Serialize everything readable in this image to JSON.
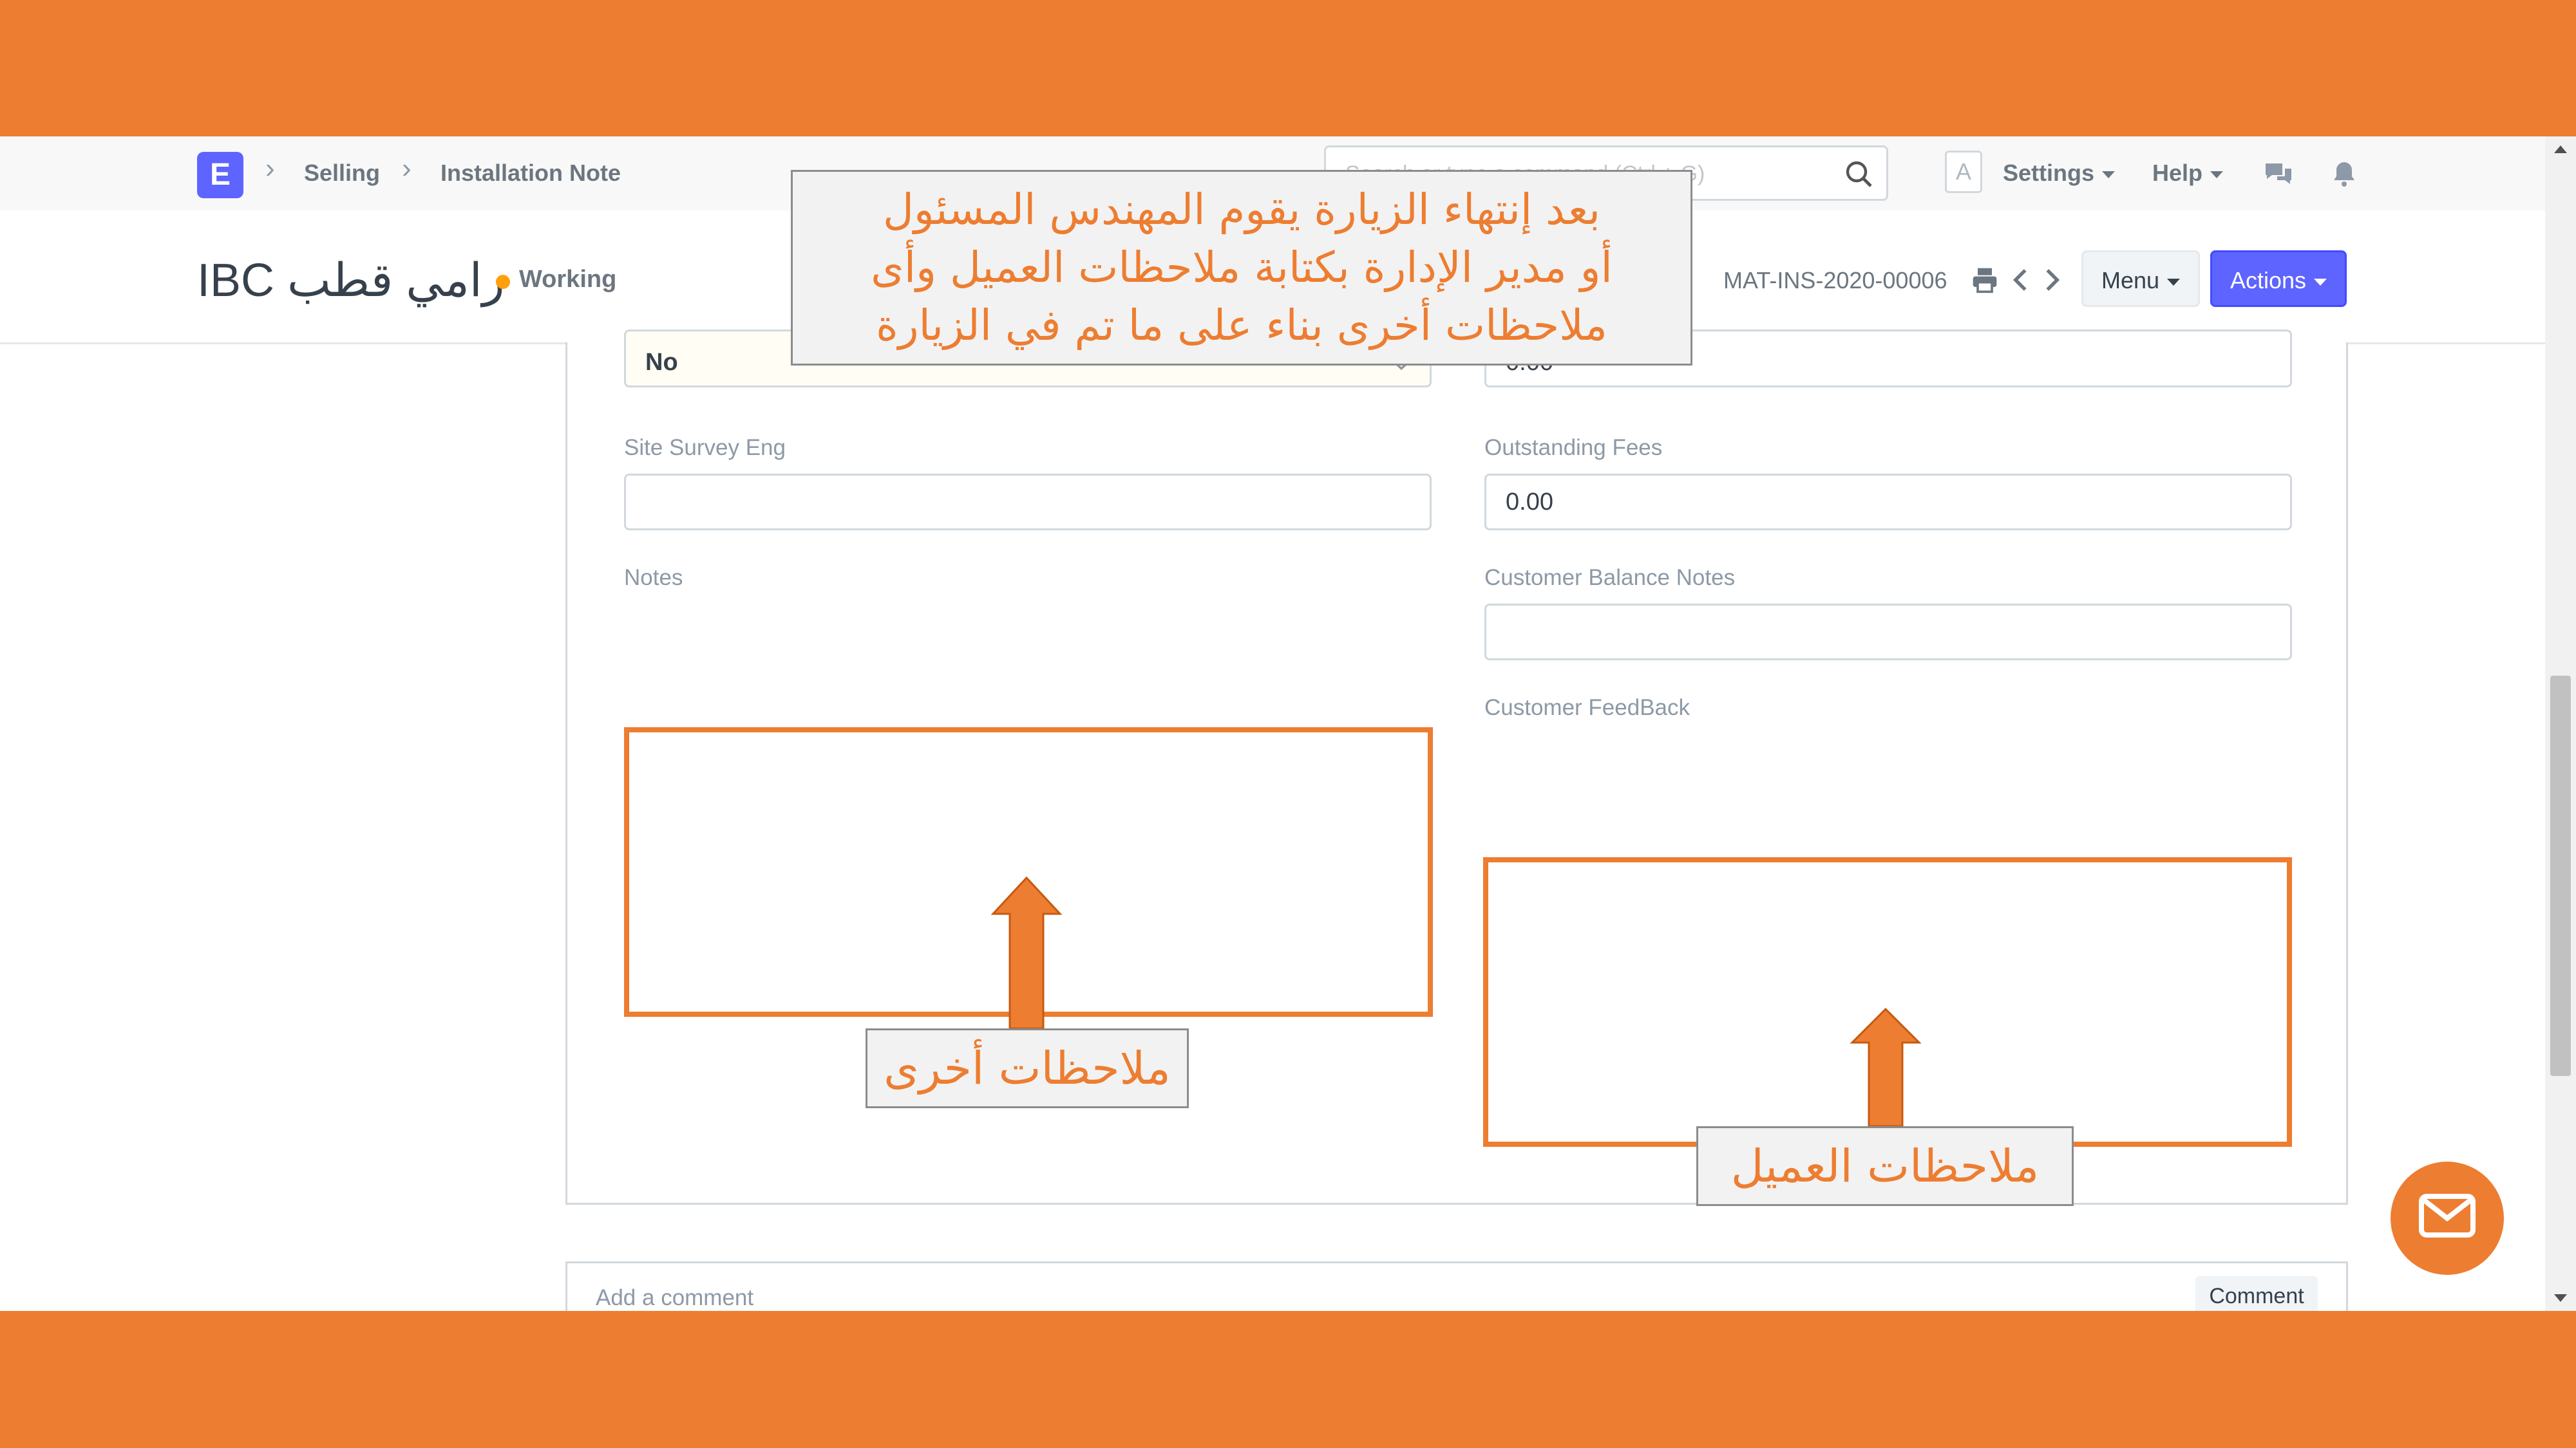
{
  "navbar": {
    "logo_letter": "E",
    "breadcrumbs": [
      "Selling",
      "Installation Note"
    ],
    "search_placeholder": "Search or type a command (Ctrl + G)",
    "avatar_letter": "A",
    "settings_label": "Settings",
    "help_label": "Help"
  },
  "page": {
    "title": "IBC رامي قطب",
    "status": "Working",
    "doc_id": "MAT-INS-2020-00006",
    "menu_label": "Menu",
    "actions_label": "Actions"
  },
  "form": {
    "top_left_value": "No",
    "top_right_value": "0.00",
    "site_survey_label": "Site Survey Eng",
    "site_survey_value": "",
    "outstanding_fees_label": "Outstanding Fees",
    "outstanding_fees_value": "0.00",
    "notes_label": "Notes",
    "customer_balance_notes_label": "Customer Balance Notes",
    "customer_feedback_label": "Customer FeedBack"
  },
  "comments": {
    "placeholder": "Add a comment",
    "button_label": "Comment"
  },
  "annotations": {
    "top_lines": [
      "بعد إنتهاء الزيارة يقوم المهندس المسئول",
      "أو مدير الإدارة بكتابة ملاحظات العميل وأى",
      "ملاحظات أخرى بناء على ما تم في الزيارة"
    ],
    "notes_callout": "ملاحظات أخرى",
    "feedback_callout": "ملاحظات العميل"
  },
  "colors": {
    "frame_orange": "#ed7d31",
    "primary_button": "#5e64ff",
    "status_dot": "#ff9f0a"
  }
}
